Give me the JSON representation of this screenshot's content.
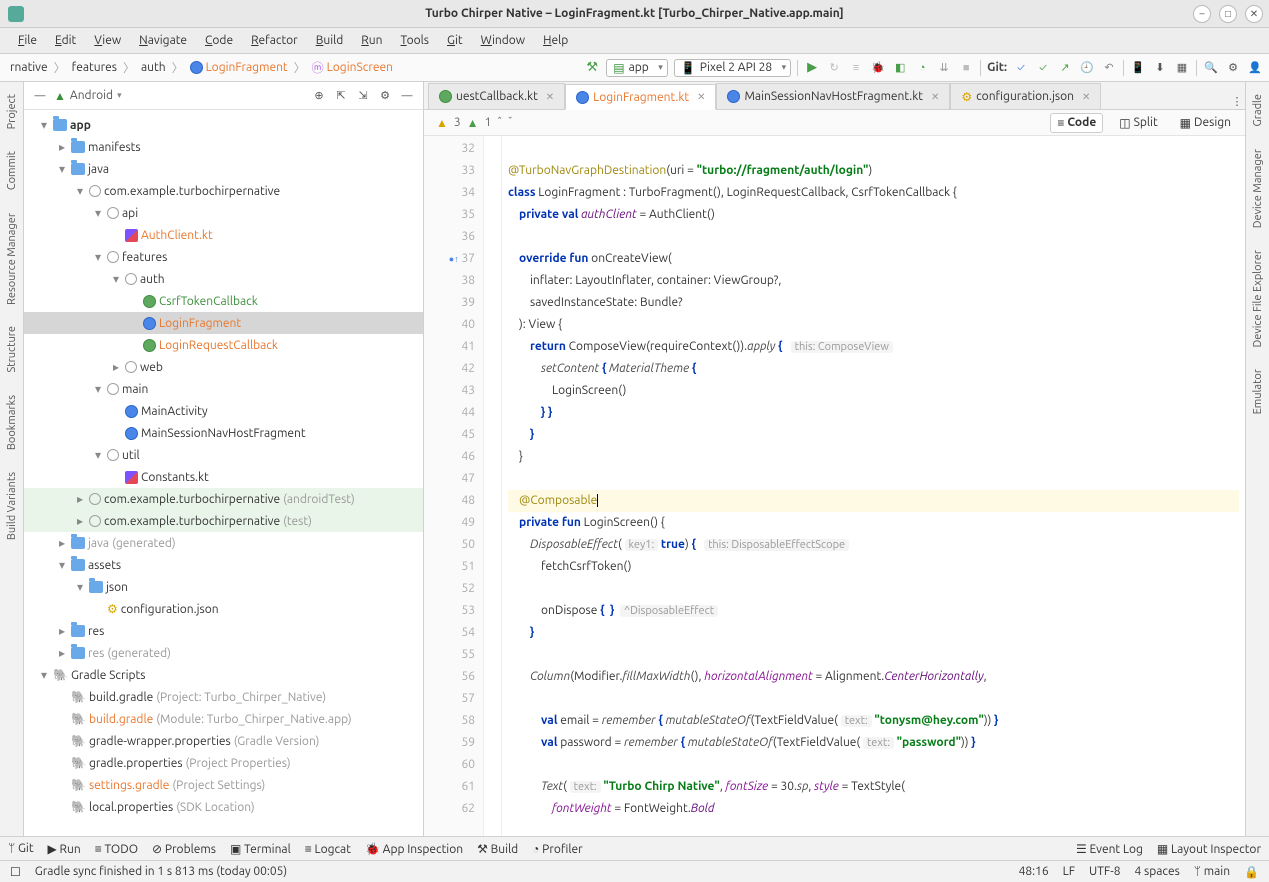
{
  "window": {
    "title": "Turbo Chirper Native – LoginFragment.kt [Turbo_Chirper_Native.app.main]"
  },
  "menu": [
    "File",
    "Edit",
    "View",
    "Navigate",
    "Code",
    "Refactor",
    "Build",
    "Run",
    "Tools",
    "Git",
    "Window",
    "Help"
  ],
  "breadcrumbs": {
    "items": [
      "rnative",
      "features",
      "auth",
      "LoginFragment",
      "LoginScreen"
    ],
    "iconAt3": true
  },
  "runConfig": {
    "app": "app",
    "device": "Pixel 2 API 28"
  },
  "gitLabel": "Git:",
  "leftRail": [
    "Project",
    "Commit",
    "Resource Manager",
    "Structure",
    "Bookmarks",
    "Build Variants"
  ],
  "rightRail": [
    "Gradle",
    "Device Manager",
    "Device File Explorer",
    "Emulator"
  ],
  "project": {
    "label": "Android",
    "tree": [
      {
        "d": 0,
        "c": "▾",
        "ic": "folder",
        "t": "app",
        "bold": true
      },
      {
        "d": 1,
        "c": "▸",
        "ic": "folder",
        "t": "manifests"
      },
      {
        "d": 1,
        "c": "▾",
        "ic": "folder",
        "t": "java"
      },
      {
        "d": 2,
        "c": "▾",
        "ic": "pkg",
        "t": "com.example.turbochirpernative"
      },
      {
        "d": 3,
        "c": "▾",
        "ic": "pkg",
        "t": "api"
      },
      {
        "d": 4,
        "c": "",
        "ic": "kt",
        "t": "AuthClient.kt",
        "cls": "orange"
      },
      {
        "d": 3,
        "c": "▾",
        "ic": "pkg",
        "t": "features"
      },
      {
        "d": 4,
        "c": "▾",
        "ic": "pkg",
        "t": "auth"
      },
      {
        "d": 5,
        "c": "",
        "ic": "int",
        "t": "CsrfTokenCallback",
        "cls": "green-txt"
      },
      {
        "d": 5,
        "c": "",
        "ic": "cls",
        "t": "LoginFragment",
        "cls": "orange",
        "sel": true
      },
      {
        "d": 5,
        "c": "",
        "ic": "int",
        "t": "LoginRequestCallback",
        "cls": "orange"
      },
      {
        "d": 4,
        "c": "▸",
        "ic": "pkg",
        "t": "web"
      },
      {
        "d": 3,
        "c": "▾",
        "ic": "pkg",
        "t": "main"
      },
      {
        "d": 4,
        "c": "",
        "ic": "cls",
        "t": "MainActivity"
      },
      {
        "d": 4,
        "c": "",
        "ic": "cls",
        "t": "MainSessionNavHostFragment"
      },
      {
        "d": 3,
        "c": "▾",
        "ic": "pkg",
        "t": "util"
      },
      {
        "d": 4,
        "c": "",
        "ic": "kt",
        "t": "Constants.kt"
      },
      {
        "d": 2,
        "c": "▸",
        "ic": "pkg",
        "t": "com.example.turbochirpernative",
        "suffix": "(androidTest)",
        "testScope": true
      },
      {
        "d": 2,
        "c": "▸",
        "ic": "pkg",
        "t": "com.example.turbochirpernative",
        "suffix": "(test)",
        "testScope": true
      },
      {
        "d": 1,
        "c": "▸",
        "ic": "folder",
        "t": "java",
        "suffix": "(generated)",
        "gray": true
      },
      {
        "d": 1,
        "c": "▾",
        "ic": "folder",
        "t": "assets"
      },
      {
        "d": 2,
        "c": "▾",
        "ic": "folder",
        "t": "json"
      },
      {
        "d": 3,
        "c": "",
        "ic": "cfg",
        "t": "configuration.json"
      },
      {
        "d": 1,
        "c": "▸",
        "ic": "folder",
        "t": "res"
      },
      {
        "d": 1,
        "c": "▸",
        "ic": "folder",
        "t": "res",
        "suffix": "(generated)",
        "gray": true
      },
      {
        "d": 0,
        "c": "▾",
        "ic": "gradle",
        "t": "Gradle Scripts"
      },
      {
        "d": 1,
        "c": "",
        "ic": "gradle",
        "t": "build.gradle",
        "suffix": "(Project: Turbo_Chirper_Native)"
      },
      {
        "d": 1,
        "c": "",
        "ic": "gradle",
        "t": "build.gradle",
        "suffix": "(Module: Turbo_Chirper_Native.app)",
        "cls": "orange"
      },
      {
        "d": 1,
        "c": "",
        "ic": "gradle",
        "t": "gradle-wrapper.properties",
        "suffix": "(Gradle Version)"
      },
      {
        "d": 1,
        "c": "",
        "ic": "gradle",
        "t": "gradle.properties",
        "suffix": "(Project Properties)"
      },
      {
        "d": 1,
        "c": "",
        "ic": "gradle",
        "t": "settings.gradle",
        "suffix": "(Project Settings)",
        "cls": "orange"
      },
      {
        "d": 1,
        "c": "",
        "ic": "gradle",
        "t": "local.properties",
        "suffix": "(SDK Location)"
      }
    ]
  },
  "tabs": [
    {
      "label": "uestCallback.kt",
      "ic": "int"
    },
    {
      "label": "LoginFragment.kt",
      "ic": "cls",
      "active": true,
      "orange": true
    },
    {
      "label": "MainSessionNavHostFragment.kt",
      "ic": "cls"
    },
    {
      "label": "configuration.json",
      "ic": "cfg"
    }
  ],
  "viewSwitch": {
    "code": "Code",
    "split": "Split",
    "design": "Design"
  },
  "inspection": {
    "yellow": "3",
    "green": "1"
  },
  "code": {
    "startLine": 32,
    "lines": [
      {
        "n": 32,
        "html": ""
      },
      {
        "n": 33,
        "html": "<span class='ann'>@TurboNavGraphDestination</span>(uri = <span class='str'>\"turbo://fragment/auth/login\"</span>)"
      },
      {
        "n": 34,
        "html": "<span class='kw'>class</span> LoginFragment : TurboFragment(), LoginRequestCallback, CsrfTokenCallback {"
      },
      {
        "n": 35,
        "html": "    <span class='kw'>private val</span> <span class='field'>authClient</span> = AuthClient()"
      },
      {
        "n": 36,
        "html": ""
      },
      {
        "n": 37,
        "html": "    <span class='kw'>override fun</span> onCreateView(",
        "marker": "impl"
      },
      {
        "n": 38,
        "html": "        inflater: LayoutInflater, container: ViewGroup?,"
      },
      {
        "n": 39,
        "html": "        savedInstanceState: Bundle?"
      },
      {
        "n": 40,
        "html": "    ): View {"
      },
      {
        "n": 41,
        "html": "        <span class='kw'>return</span> ComposeView(requireContext()).<span class='fn'>apply</span> <span class='kw'>{</span>   <span class='hint'>this: ComposeView</span>"
      },
      {
        "n": 42,
        "html": "            <span class='fn'>setContent</span> <span class='kw'>{</span> <span class='fn'>MaterialTheme</span> <span class='kw'>{</span>"
      },
      {
        "n": 43,
        "html": "                LoginScreen()"
      },
      {
        "n": 44,
        "html": "            <span class='kw'>} }</span>"
      },
      {
        "n": 45,
        "html": "        <span class='kw'>}</span>"
      },
      {
        "n": 46,
        "html": "    }"
      },
      {
        "n": 47,
        "html": ""
      },
      {
        "n": 48,
        "html": "    <span class='ann'>@Composable</span><span class='caret-cursor'></span>",
        "hl": true,
        "bulb": true
      },
      {
        "n": 49,
        "html": "    <span class='kw'>private fun</span> LoginScreen() {"
      },
      {
        "n": 50,
        "html": "        <span class='fn'>DisposableEffect</span>( <span class='hint'>key1:</span> <span class='kw'>true</span>) <span class='kw'>{</span>   <span class='hint'>this: DisposableEffectScope</span>"
      },
      {
        "n": 51,
        "html": "            fetchCsrfToken()"
      },
      {
        "n": 52,
        "html": ""
      },
      {
        "n": 53,
        "html": "            onDispose <span class='kw'>{  }</span>  <span class='hint'>^DisposableEffect</span>"
      },
      {
        "n": 54,
        "html": "        <span class='kw'>}</span>"
      },
      {
        "n": 55,
        "html": ""
      },
      {
        "n": 56,
        "html": "        <span class='fn'>Column</span>(Modifier.<span class='fn'>fillMaxWidth</span>(), <span class='purple'>horizontalAlignment</span> = Alignment.<span class='field'>CenterHorizontally</span>,"
      },
      {
        "n": 57,
        "html": ""
      },
      {
        "n": 58,
        "html": "            <span class='kw'>val</span> email = <span class='fn'>remember</span> <span class='kw'>{</span> <span class='fn'>mutableStateOf</span>(TextFieldValue( <span class='hint'>text:</span> <span class='str'>\"tonysm@hey.com\"</span>)) <span class='kw'>}</span>"
      },
      {
        "n": 59,
        "html": "            <span class='kw'>val</span> password = <span class='fn'>remember</span> <span class='kw'>{</span> <span class='fn'>mutableStateOf</span>(TextFieldValue( <span class='hint'>text:</span> <span class='str'>\"password\"</span>)) <span class='kw'>}</span>"
      },
      {
        "n": 60,
        "html": ""
      },
      {
        "n": 61,
        "html": "            <span class='fn'>Text</span>( <span class='hint'>text:</span> <span class='str'>\"Turbo Chirp Native\"</span>, <span class='purple'>fontSize</span> = 30.<span class='fn'>sp</span>, <span class='purple'>style</span> = TextStyle("
      },
      {
        "n": 62,
        "html": "                <span class='purple'>fontWeight</span> = FontWeight.<span class='field'>Bold</span>"
      }
    ]
  },
  "bottom": [
    "Git",
    "Run",
    "TODO",
    "Problems",
    "Terminal",
    "Logcat",
    "App Inspection",
    "Build",
    "Profiler"
  ],
  "bottomRight": [
    "Event Log",
    "Layout Inspector"
  ],
  "status": {
    "msg": "Gradle sync finished in 1 s 813 ms (today 00:05)",
    "pos": "48:16",
    "lf": "LF",
    "enc": "UTF-8",
    "indent": "4 spaces",
    "branch": "main",
    "lock": "🔒"
  }
}
